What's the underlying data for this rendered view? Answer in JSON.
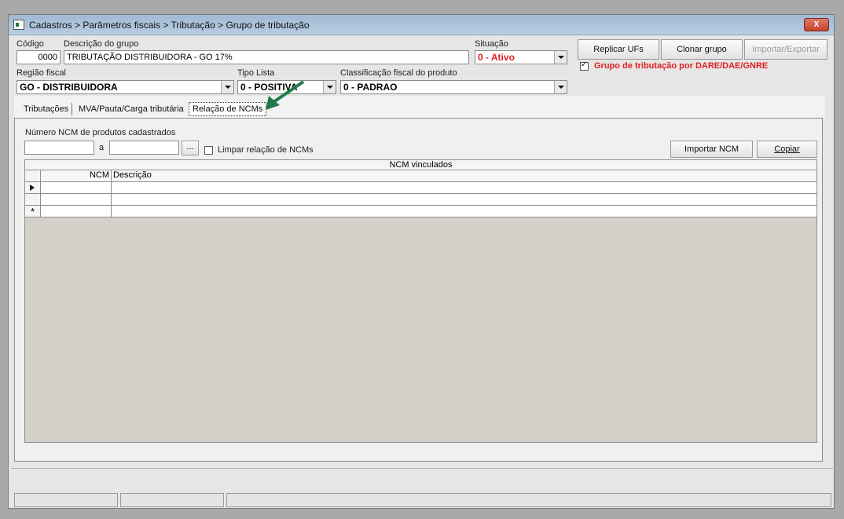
{
  "window": {
    "title": "Cadastros > Parâmetros fiscais > Tributação > Grupo de tributação",
    "close_label": "X"
  },
  "header": {
    "codigo_label": "Código",
    "codigo_value": "0000",
    "descricao_label": "Descrição do grupo",
    "descricao_value": "TRIBUTAÇÃO DISTRIBUIDORA - GO 17%",
    "situacao_label": "Situação",
    "situacao_value": "0 - Ativo",
    "regiao_label": "Região fiscal",
    "regiao_value": "GO - DISTRIBUIDORA",
    "tipo_lista_label": "Tipo Lista",
    "tipo_lista_value": "0 - POSITIVA",
    "classificacao_label": "Classificação fiscal do produto",
    "classificacao_value": "0 - PADRAO"
  },
  "actions": {
    "replicar_label": "Replicar UFs",
    "clonar_label": "Clonar grupo",
    "importar_exportar_label": "Importar/Exportar",
    "dare_checkbox_label": "Grupo de tributação por DARE/DAE/GNRE",
    "dare_checked": true
  },
  "tabs": [
    {
      "label": "Tributações"
    },
    {
      "label": "MVA/Pauta/Carga tributária"
    },
    {
      "label": "Relação de NCMs"
    }
  ],
  "ncm_panel": {
    "numero_label": "Número  NCM de produtos cadastrados",
    "from_value": "",
    "to_label": "a",
    "to_value": "",
    "browse_label": "...",
    "limpar_label": "Limpar relação de NCMs",
    "importar_label": "Importar NCM",
    "copiar_label": "Copiar"
  },
  "grid": {
    "title": "NCM vinculados",
    "columns": [
      "NCM",
      "Descrição"
    ],
    "new_row_marker": "*"
  },
  "colors": {
    "situacao_text": "#e02020",
    "dare_text": "#e02020",
    "arrow_annotation": "#1f7a4a"
  }
}
